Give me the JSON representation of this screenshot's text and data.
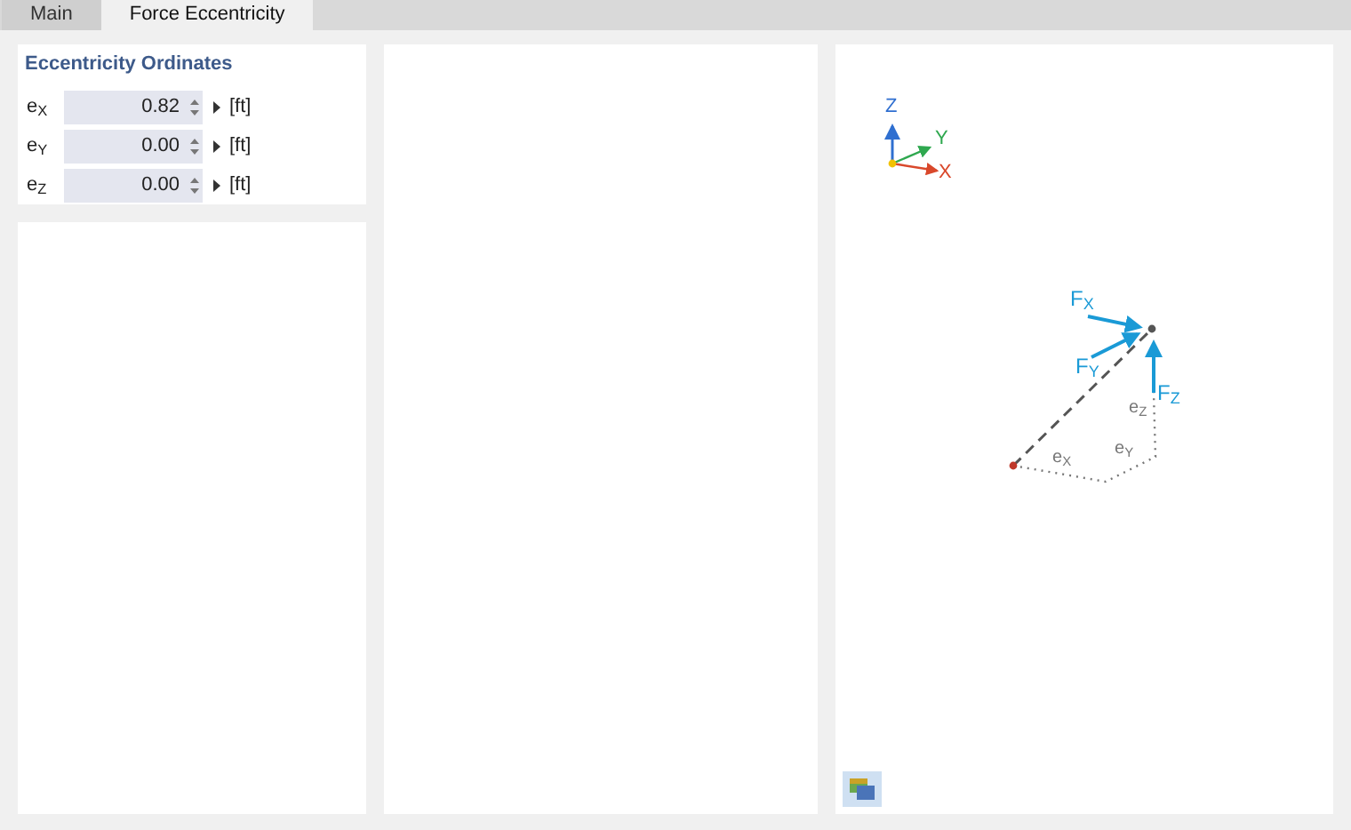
{
  "tabs": [
    {
      "label": "Main",
      "selected": false
    },
    {
      "label": "Force Eccentricity",
      "selected": true
    }
  ],
  "eccentricity": {
    "title": "Eccentricity Ordinates",
    "rows": [
      {
        "label": "e$_{X}$",
        "value": "0.82",
        "unit": "[ft]"
      },
      {
        "label": "e$_{Y}$",
        "value": "0.00",
        "unit": "[ft]"
      },
      {
        "label": "e$_{Z}$",
        "value": "0.00",
        "unit": "[ft]"
      }
    ]
  },
  "diagram": {
    "axes": [
      "Z",
      "Y",
      "X"
    ],
    "labels": [
      "F$_{X}$",
      "F$_{Y}$",
      "F$_{Z}$",
      "e$_{Z}$",
      "e$_{Y}$",
      "e$_{X}$"
    ]
  }
}
